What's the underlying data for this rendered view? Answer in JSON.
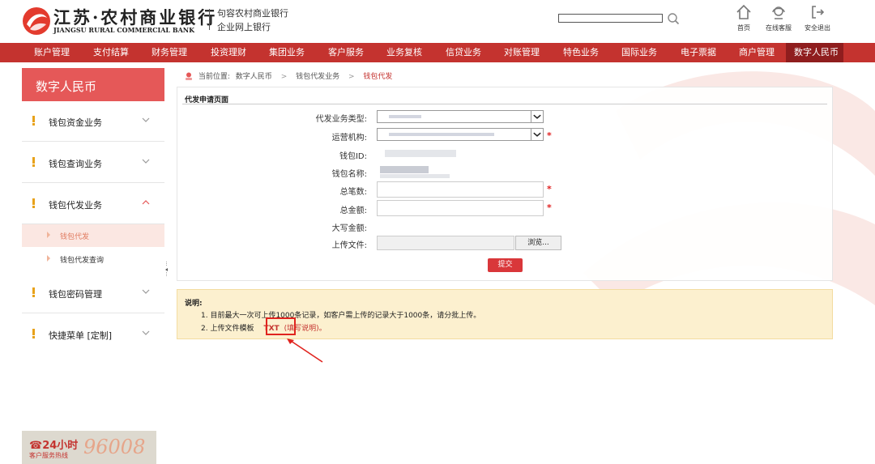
{
  "header": {
    "brand_cn": "江苏·农村商业银行",
    "brand_en": "JIANGSU RURAL COMMERCIAL BANK",
    "sub_line1": "句容农村商业银行",
    "sub_line2": "企业网上银行",
    "search_value": "",
    "links": [
      {
        "label": "首页",
        "icon": "home-icon"
      },
      {
        "label": "在线客服",
        "icon": "headset-icon"
      },
      {
        "label": "安全退出",
        "icon": "logout-icon"
      }
    ]
  },
  "nav": {
    "items": [
      "账户管理",
      "支付结算",
      "财务管理",
      "投资理财",
      "集团业务",
      "客户服务",
      "业务复核",
      "信贷业务",
      "对账管理",
      "特色业务",
      "国际业务",
      "电子票据",
      "商户管理",
      "数字人民币"
    ],
    "active": "数字人民币"
  },
  "sidebar": {
    "title": "数字人民币",
    "groups": [
      {
        "label": "钱包资金业务",
        "expanded": false
      },
      {
        "label": "钱包查询业务",
        "expanded": false
      },
      {
        "label": "钱包代发业务",
        "expanded": true
      },
      {
        "label": "钱包密码管理",
        "expanded": false
      },
      {
        "label": "快捷菜单 [定制]",
        "expanded": false
      }
    ],
    "subitems": [
      {
        "label": "钱包代发",
        "active": true
      },
      {
        "label": "钱包代发查询",
        "active": false
      }
    ],
    "hotline": {
      "phone_label": "☎24小时",
      "sub_label": "客户服务热线",
      "number": "96008"
    }
  },
  "breadcrumb": {
    "prefix": "当前位置:",
    "items": [
      "数字人民币",
      "钱包代发业务",
      "钱包代发"
    ]
  },
  "form": {
    "title": "代发申请页面",
    "fields": {
      "business_type": {
        "label": "代发业务类型:",
        "required": false
      },
      "operator": {
        "label": "运营机构:",
        "required": true
      },
      "wallet_id": {
        "label": "钱包ID:",
        "required": false
      },
      "wallet_name": {
        "label": "钱包名称:",
        "required": false
      },
      "total_count": {
        "label": "总笔数:",
        "value": "",
        "required": true
      },
      "total_amount": {
        "label": "总金额:",
        "value": "",
        "required": true
      },
      "amount_upper": {
        "label": "大写金额:",
        "value": ""
      },
      "upload_file": {
        "label": "上传文件:"
      }
    },
    "required_mark": "*",
    "browse_label": "浏览...",
    "submit_label": "提交"
  },
  "note": {
    "title": "说明:",
    "line1": "1. 目前最大一次可上传1000条记录，如客户需上传的记录大于1000条，请分批上传。",
    "line2_prefix": "2. 上传文件模板",
    "template_link": "TXT",
    "help_link": "(填写说明)。"
  },
  "colors": {
    "brand_red": "#c4332f",
    "nav_active": "#8f1d1e",
    "sidebar_title": "#e55858",
    "submit": "#d9373a",
    "note_bg": "#fcf0cf",
    "highlight": "#e0241f"
  }
}
